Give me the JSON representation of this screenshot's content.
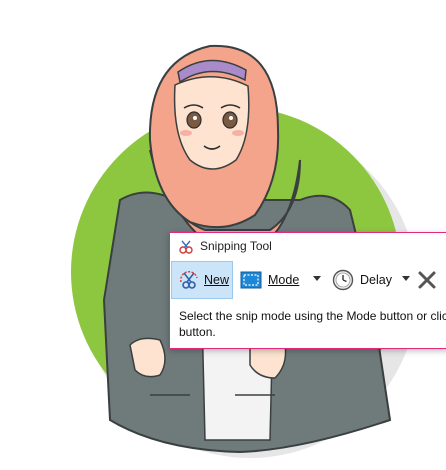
{
  "window": {
    "title": "Snipping Tool",
    "accent_color": "#e5287c"
  },
  "toolbar": {
    "new_label": "New",
    "mode_label": "Mode",
    "delay_label": "Delay",
    "new_icon": "scissors-icon",
    "mode_icon": "rectangle-snip-icon",
    "delay_icon": "clock-icon",
    "cancel_icon": "close-icon"
  },
  "message": {
    "line1": "Select the snip mode using the Mode button or clic",
    "line2": "button."
  },
  "background": {
    "circle_color": "#8dc63f",
    "hijab_color": "#f4a48a"
  }
}
